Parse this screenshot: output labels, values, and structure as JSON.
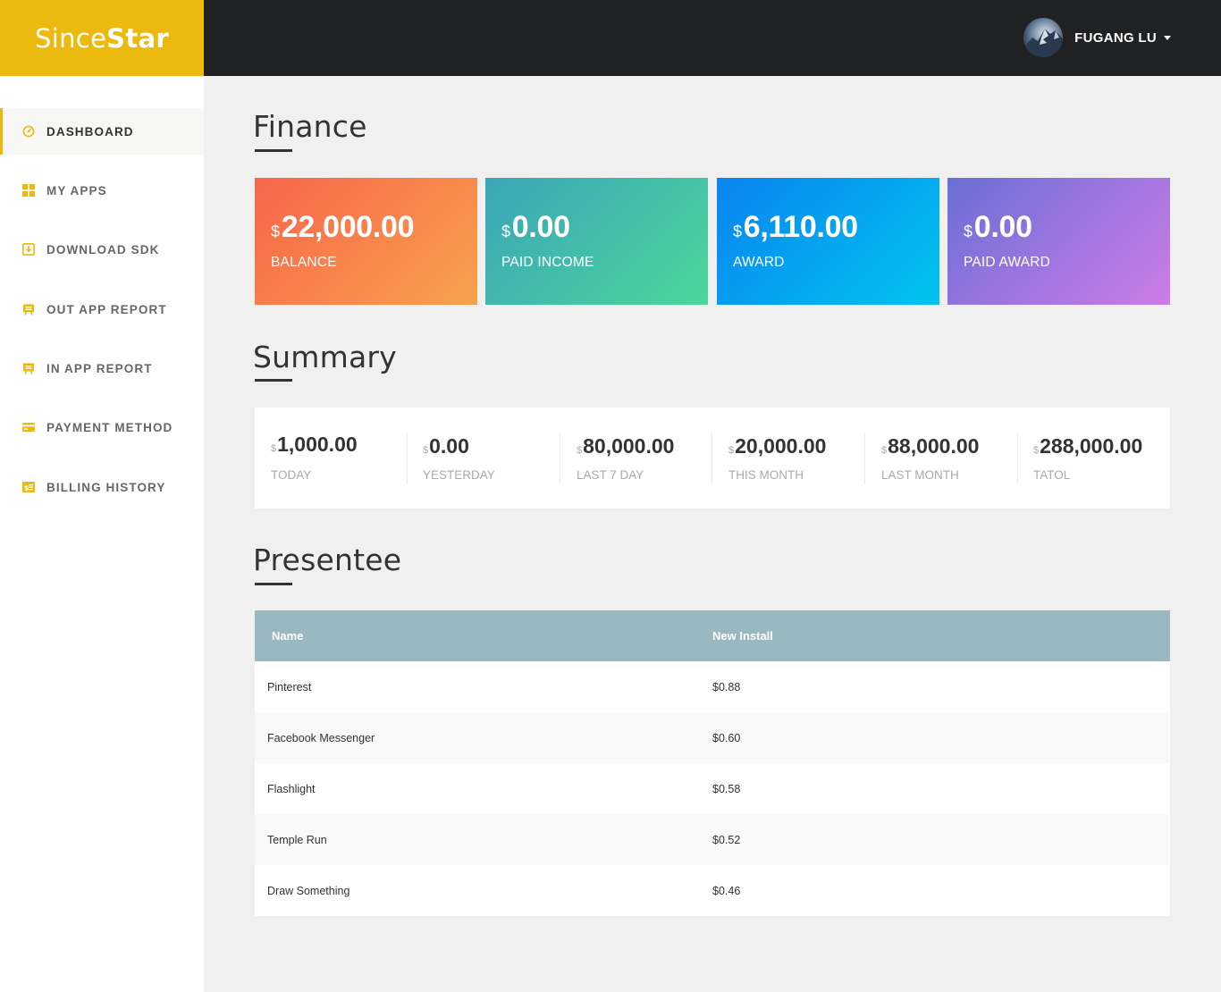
{
  "brand": {
    "light": "Since",
    "bold": "Star",
    "color": "#ecb90f"
  },
  "user": {
    "name": "FUGANG LU",
    "menu_icon": "caret-down-icon"
  },
  "sidebar": {
    "items": [
      {
        "label": "DASHBOARD",
        "icon": "dashboard-icon",
        "active": true
      },
      {
        "label": "MY APPS",
        "icon": "apps-grid-icon",
        "active": false
      },
      {
        "label": "DOWNLOAD SDK",
        "icon": "download-icon",
        "active": false
      },
      {
        "label": "OUT APP REPORT",
        "icon": "report-icon",
        "active": false
      },
      {
        "label": "IN APP REPORT",
        "icon": "report-icon",
        "active": false
      },
      {
        "label": "PAYMENT METHOD",
        "icon": "credit-card-icon",
        "active": false
      },
      {
        "label": "BILLING HISTORY",
        "icon": "billing-icon",
        "active": false
      }
    ]
  },
  "finance": {
    "title": "Finance",
    "cards": [
      {
        "currency": "$",
        "amount": "22,000.00",
        "label": "BALANCE",
        "colors": [
          "#f7654a",
          "#f8a24d"
        ]
      },
      {
        "currency": "$",
        "amount": "0.00",
        "label": "PAID INCOME",
        "colors": [
          "#3aa5b8",
          "#4cd69a"
        ]
      },
      {
        "currency": "$",
        "amount": "6,110.00",
        "label": "AWARD",
        "colors": [
          "#0a84f0",
          "#00c4ee"
        ]
      },
      {
        "currency": "$",
        "amount": "0.00",
        "label": "PAID AWARD",
        "colors": [
          "#6a6fd6",
          "#cd7be6"
        ]
      }
    ]
  },
  "summary": {
    "title": "Summary",
    "items": [
      {
        "currency": "$",
        "amount": "1,000.00",
        "label": "TODAY"
      },
      {
        "currency": "$",
        "amount": "0.00",
        "label": "YESTERDAY"
      },
      {
        "currency": "$",
        "amount": "80,000.00",
        "label": "LAST 7 DAY"
      },
      {
        "currency": "$",
        "amount": "20,000.00",
        "label": "THIS MONTH"
      },
      {
        "currency": "$",
        "amount": "88,000.00",
        "label": "LAST MONTH"
      },
      {
        "currency": "$",
        "amount": "288,000.00",
        "label": "TATOL"
      }
    ]
  },
  "presentee": {
    "title": "Presentee",
    "columns": [
      "Name",
      "New Install"
    ],
    "rows": [
      [
        "Pinterest",
        "$0.88"
      ],
      [
        "Facebook Messenger",
        "$0.60"
      ],
      [
        "Flashlight",
        "$0.58"
      ],
      [
        "Temple Run",
        "$0.52"
      ],
      [
        "Draw Something",
        "$0.46"
      ]
    ]
  }
}
